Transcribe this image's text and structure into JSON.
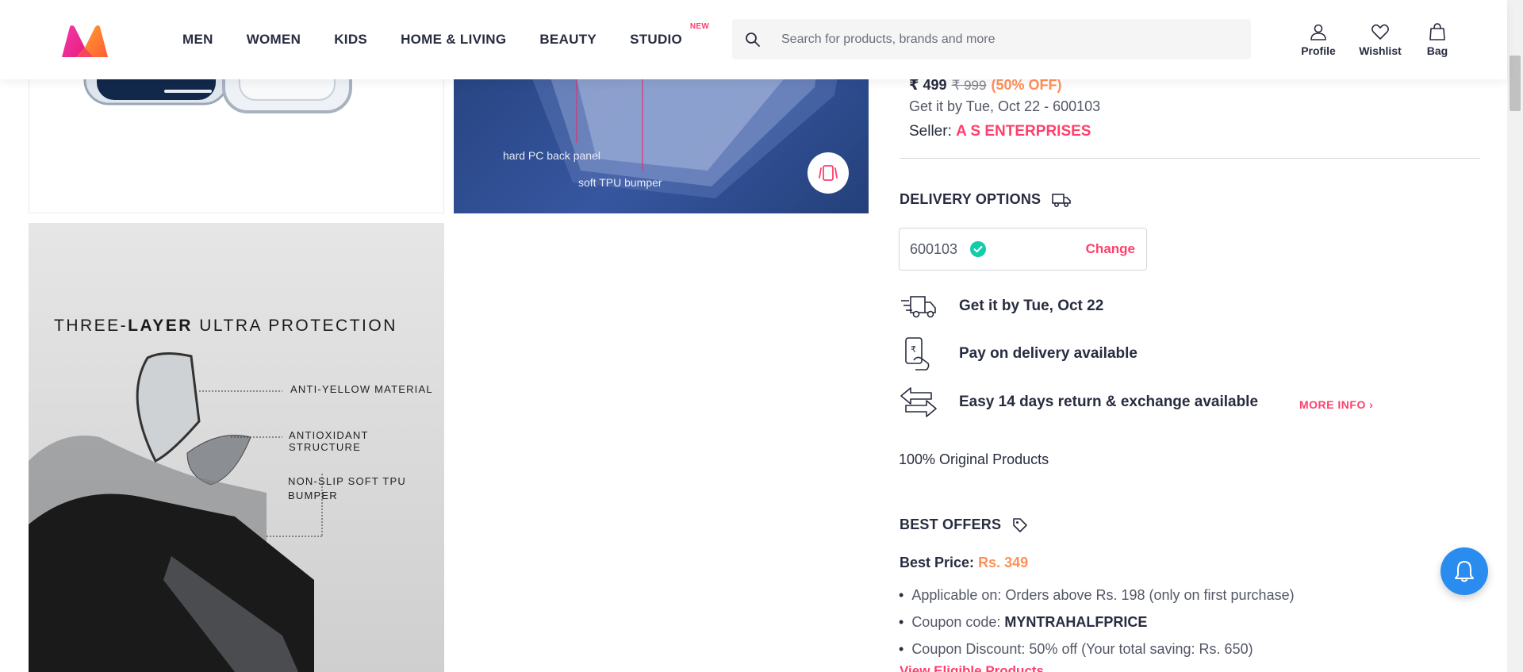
{
  "header": {
    "nav": [
      "MEN",
      "WOMEN",
      "KIDS",
      "HOME & LIVING",
      "BEAUTY",
      "STUDIO"
    ],
    "studio_badge": "NEW",
    "search_placeholder": "Search for products, brands and more",
    "actions": {
      "profile": "Profile",
      "wishlist": "Wishlist",
      "bag": "Bag"
    }
  },
  "gallery": {
    "image2_captions": [
      "hard PC back panel",
      "soft TPU bumper"
    ],
    "image3": {
      "title_pre": "THREE-",
      "title_bold": "LAYER",
      "title_post": " ULTRA PROTECTION",
      "labels": [
        "ANTI-YELLOW MATERIAL",
        "ANTIOXIDANT STRUCTURE",
        "NON-SLIP SOFT TPU",
        "BUMPER"
      ]
    }
  },
  "product": {
    "price": "₹ 499",
    "mrp": "₹ 999",
    "discount": "(50% OFF)",
    "get_it": "Get it by Tue, Oct 22 - 600103",
    "seller_label": "Seller:",
    "seller_name": "A S ENTERPRISES"
  },
  "delivery": {
    "title": "DELIVERY OPTIONS",
    "pincode": "600103",
    "change": "Change",
    "rows": [
      "Get it by Tue, Oct 22",
      "Pay on delivery available",
      "Easy 14 days return & exchange available"
    ],
    "more_info": "MORE INFO",
    "original": "100% Original Products"
  },
  "offers": {
    "title": "BEST OFFERS",
    "best_price_label": "Best Price:",
    "best_price_value": "Rs. 349",
    "items": [
      {
        "label": "Applicable on:",
        "value": "Orders above Rs. 198 (only on first purchase)"
      },
      {
        "label": "Coupon code:",
        "value": "MYNTRAHALFPRICE"
      },
      {
        "label": "Coupon Discount:",
        "value": "50% off (Your total saving: Rs. 650)"
      }
    ],
    "view_eligible": "View Eligible Products"
  },
  "colors": {
    "accent": "#ff3f6c",
    "offer": "#ff905a",
    "notify": "#2b8cf0"
  }
}
